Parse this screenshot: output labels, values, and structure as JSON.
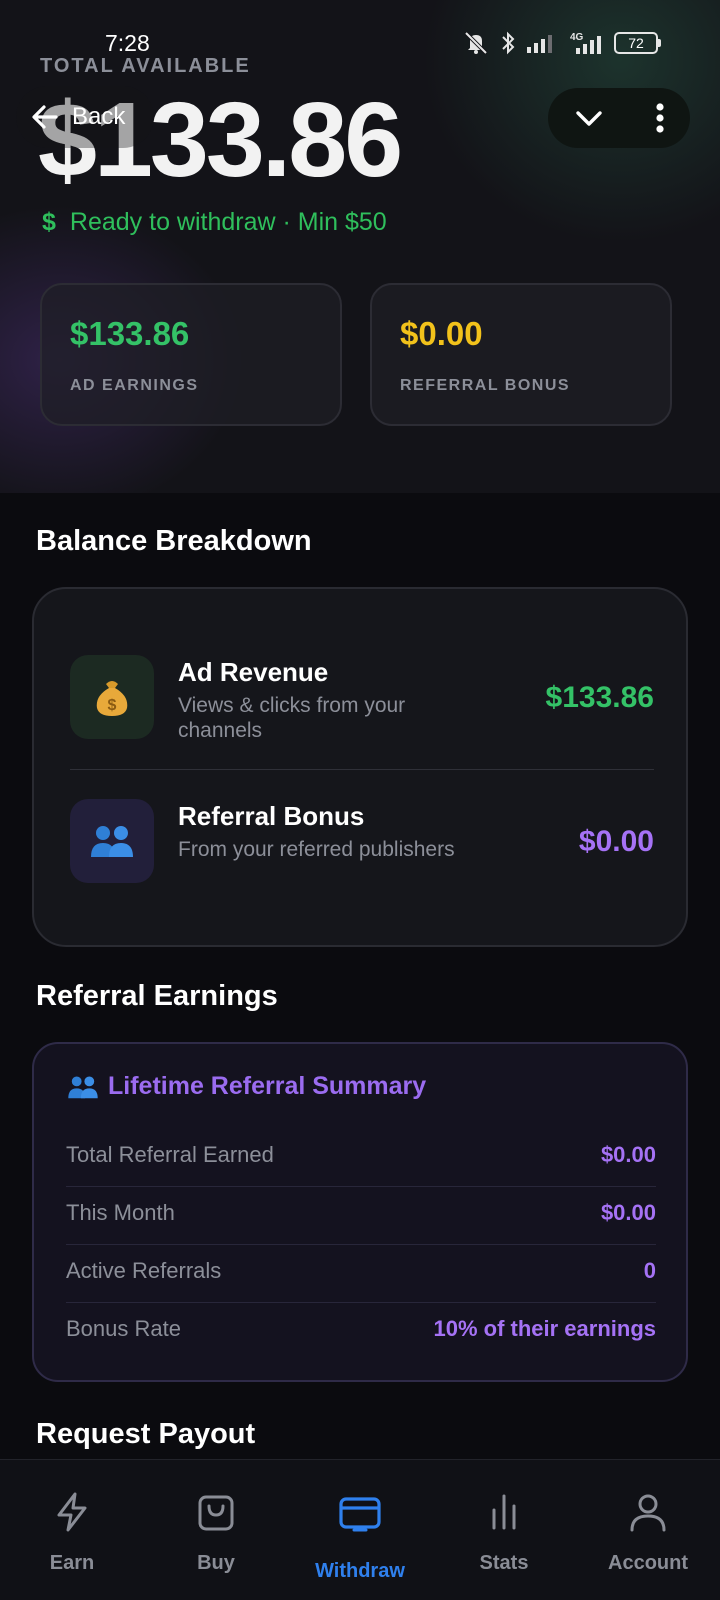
{
  "status_bar": {
    "time": "7:28",
    "battery": "72"
  },
  "header": {
    "back_label": "Back",
    "total_label": "TOTAL AVAILABLE",
    "total_amount": "$133.86",
    "ready_icon": "$",
    "ready_text": "Ready to withdraw · Min $50"
  },
  "stats": [
    {
      "value": "$133.86",
      "label": "AD EARNINGS",
      "color": "#34c267"
    },
    {
      "value": "$0.00",
      "label": "REFERRAL BONUS",
      "color": "#f2c21b"
    }
  ],
  "breakdown": {
    "title": "Balance Breakdown",
    "items": [
      {
        "icon": "money-bag-icon",
        "title": "Ad Revenue",
        "subtitle": "Views & clicks from your channels",
        "amount": "$133.86",
        "color": "#34c267"
      },
      {
        "icon": "people-icon",
        "title": "Referral Bonus",
        "subtitle": "From your referred publishers",
        "amount": "$0.00",
        "color": "#a572f5"
      }
    ]
  },
  "referral": {
    "section_title": "Referral Earnings",
    "card_title": "Lifetime Referral Summary",
    "rows": [
      {
        "label": "Total Referral Earned",
        "value": "$0.00"
      },
      {
        "label": "This Month",
        "value": "$0.00"
      },
      {
        "label": "Active Referrals",
        "value": "0"
      },
      {
        "label": "Bonus Rate",
        "value": "10% of their earnings"
      }
    ]
  },
  "payout": {
    "title": "Request Payout"
  },
  "nav": [
    {
      "label": "Earn",
      "icon": "lightning-icon"
    },
    {
      "label": "Buy",
      "icon": "shopping-bag-icon"
    },
    {
      "label": "Withdraw",
      "icon": "card-icon",
      "active": true
    },
    {
      "label": "Stats",
      "icon": "bar-chart-icon"
    },
    {
      "label": "Account",
      "icon": "user-icon"
    }
  ]
}
